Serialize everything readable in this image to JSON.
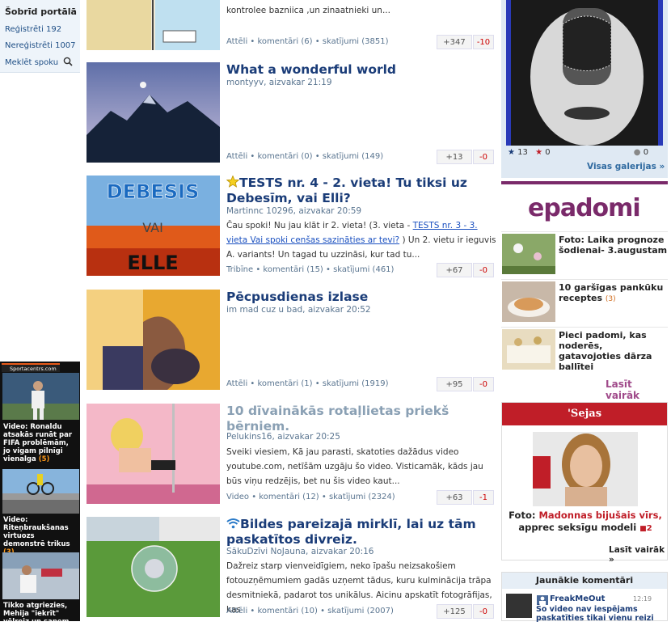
{
  "left": {
    "heading": "Šobrīd portālā",
    "registered": "Reģistrēti 192",
    "unregistered": "Nereģistrēti 1007",
    "search": "Meklēt spoku",
    "sport_logo": "Sportacentrs.com",
    "sport_items": [
      {
        "text": "Video: Ronaldu atsakās runāt par FIFA problēmām, jo vigam pilnīgi vienalga",
        "count": "(5)"
      },
      {
        "text": "Video: Riteņbraukšanas virtuozs demonstrē trikus",
        "count": "(3)"
      },
      {
        "text": "Tikko atgriezies, Mehija \"iekrīt\" vēlreiz un saņem",
        "count": ""
      }
    ]
  },
  "articles": [
    {
      "title": "",
      "meta": "",
      "excerpt": [
        "kontrolee bazniica ,un zinaatnieki un..."
      ],
      "excerpt_link": "",
      "excerpt_after": "",
      "foot": "Attēli • komentāri (6) • skatījumi (3851)",
      "plus": "+347",
      "minus": "-10"
    },
    {
      "title": "What a wonderful world",
      "meta": "montyyv, aizvakar 21:19",
      "excerpt": [],
      "excerpt_link": "",
      "excerpt_after": "",
      "foot": "Attēli • komentāri (0) • skatījumi (149)",
      "plus": "+13",
      "minus": "-0"
    },
    {
      "title": "TESTS nr. 4 - 2. vieta! Tu tiksi uz Debesīm, vai Elli?",
      "meta": "Martinnc 10296, aizvakar 20:59",
      "excerpt": [
        "Čau spoki! Nu jau klāt ir 2. vieta! (3. vieta - "
      ],
      "excerpt_link": "TESTS nr. 3 - 3. vieta Vai spoki cenšas sazināties ar tevi?",
      "excerpt_after": " ) Un 2. vietu ir ieguvis A. variants! Un tagad tu uzzināsi, kur tad tu...",
      "foot": "Tribīne • komentāri (15) • skatījumi (461)",
      "plus": "+67",
      "minus": "-0"
    },
    {
      "title": "Pēcpusdienas izlase",
      "meta": "im mad cuz u bad, aizvakar 20:52",
      "excerpt": [],
      "excerpt_link": "",
      "excerpt_after": "",
      "foot": "Attēli • komentāri (1) • skatījumi (1919)",
      "plus": "+95",
      "minus": "-0"
    },
    {
      "title": "10 dīvainākās rotaļlietas priekš bērniem.",
      "meta": "Pelukins16, aizvakar 20:25",
      "excerpt": [
        "Sveiki viesiem, Kā jau parasti, skatoties dažādus video youtube.com, netīšām uzgāju šo video. Visticamāk, kāds jau būs viņu redzējis, bet nu šis video kaut..."
      ],
      "excerpt_link": "",
      "excerpt_after": "",
      "foot": "Video • komentāri (12) • skatījumi (2324)",
      "plus": "+63",
      "minus": "-1"
    },
    {
      "title": "Bildes pareizajā mirklī, lai uz tām paskatītos divreiz.",
      "meta": "SākuDzīvi NoJauna, aizvakar 20:16",
      "excerpt": [
        "Dažreiz starp vienveidīgiem, neko īpašu neizsakošiem fotouzņēmumiem gadās uzņemt tādus, kuru kulminācija trāpa desmitniekā, padarot tos unikālus. Aicinu apskatīt fotogrāfijas, kas"
      ],
      "excerpt_link": "",
      "excerpt_after": "",
      "foot": "Attēli • komentāri (10) • skatījumi (2007)",
      "plus": "+125",
      "minus": "-0"
    }
  ],
  "top_fragment": "kontrolee bazniica ,un zinaatnieki un...",
  "gallery": {
    "stars": "13",
    "red": "0",
    "comments": "0",
    "link": "Visas galerijas »"
  },
  "epa": {
    "logo": "epadomi",
    "items": [
      {
        "text": "Foto: Laika prognoze šodienai- 3.augustam",
        "count": ""
      },
      {
        "text": "10 garšīgas pankūku receptes",
        "count": "(3)"
      },
      {
        "text": "Pieci padomi, kas noderēs, gatavojoties dārza ballītei",
        "count": ""
      }
    ],
    "more": "Lasīt vairāk"
  },
  "sejas": {
    "heading": "'Sejas",
    "caption_prefix": "Foto: ",
    "caption_red": "Madonnas bijušais vīrs,",
    "caption_rest": " apprec seksīgu modeli",
    "count": "2",
    "more": "Lasīt vairāk »"
  },
  "comments": {
    "heading": "Jaunākie komentāri",
    "user": "FreakMeOut",
    "time": "12:19",
    "text": "Šo video nav iespējams paskatīties tikai vienu reizi"
  },
  "colors": {
    "title": "#1a3c78",
    "accent": "#7a2a6a",
    "sejas": "#c01e28"
  }
}
